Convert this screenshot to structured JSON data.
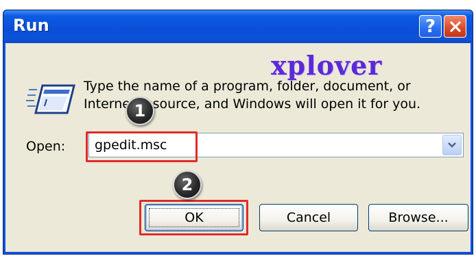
{
  "window": {
    "title": "Run",
    "help_glyph": "?",
    "close_icon": "close-icon"
  },
  "watermark": "xplover",
  "description": "Type the name of a program, folder, document, or Internet resource, and Windows will open it for you.",
  "open": {
    "label": "Open:",
    "value": "gpedit.msc"
  },
  "buttons": {
    "ok": "OK",
    "cancel": "Cancel",
    "browse": "Browse..."
  },
  "annotations": {
    "step1": "1",
    "step2": "2",
    "highlight_color": "#e12a2a"
  },
  "colors": {
    "titlebar": "#0a4fd6",
    "client_bg": "#ece9d8",
    "watermark": "#5b2ad6"
  }
}
